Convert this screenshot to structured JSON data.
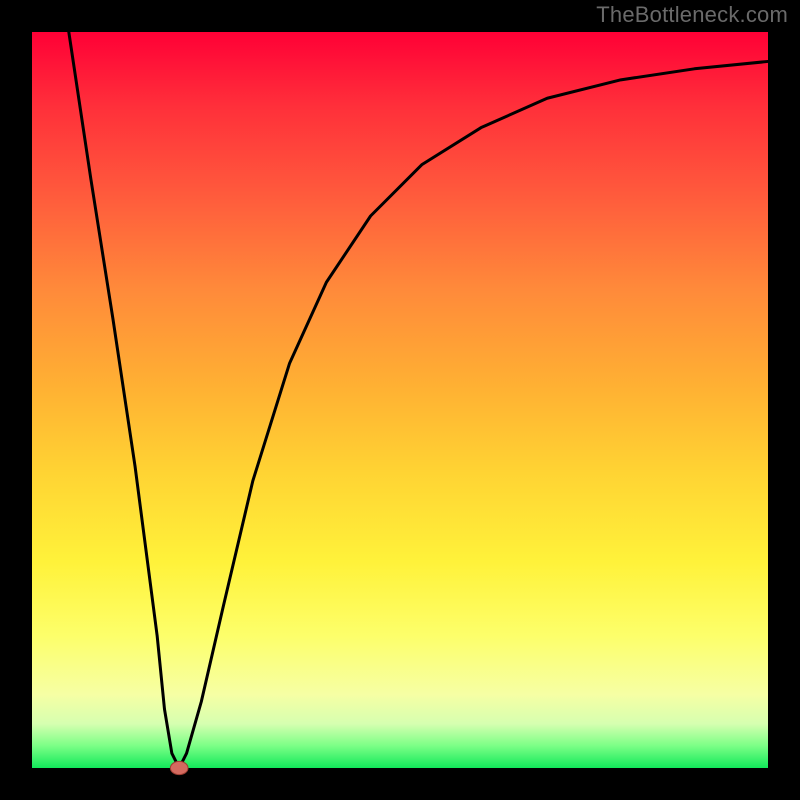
{
  "watermark": "TheBottleneck.com",
  "colors": {
    "frame": "#000000",
    "marker_fill": "#d46a5f",
    "marker_stroke": "#9e3d32",
    "curve_stroke": "#000000"
  },
  "chart_data": {
    "type": "line",
    "title": "",
    "xlabel": "",
    "ylabel": "",
    "xlim": [
      0,
      100
    ],
    "ylim": [
      0,
      100
    ],
    "grid": false,
    "legend": false,
    "note": "Axes carry no tick labels in the image; values below are normalized 0–100 in plot-area coordinates (x left→right, y bottom→top) estimated from the pixels.",
    "series": [
      {
        "name": "bottleneck-curve",
        "x": [
          5,
          8,
          11,
          14,
          17,
          18,
          19,
          20,
          21,
          23,
          26,
          30,
          35,
          40,
          46,
          53,
          61,
          70,
          80,
          90,
          100
        ],
        "values": [
          100,
          80,
          61,
          41,
          18,
          8,
          2,
          0,
          2,
          9,
          22,
          39,
          55,
          66,
          75,
          82,
          87,
          91,
          93.5,
          95,
          96
        ]
      }
    ],
    "markers": [
      {
        "name": "minimum-point",
        "x": 20,
        "y": 0
      }
    ]
  }
}
